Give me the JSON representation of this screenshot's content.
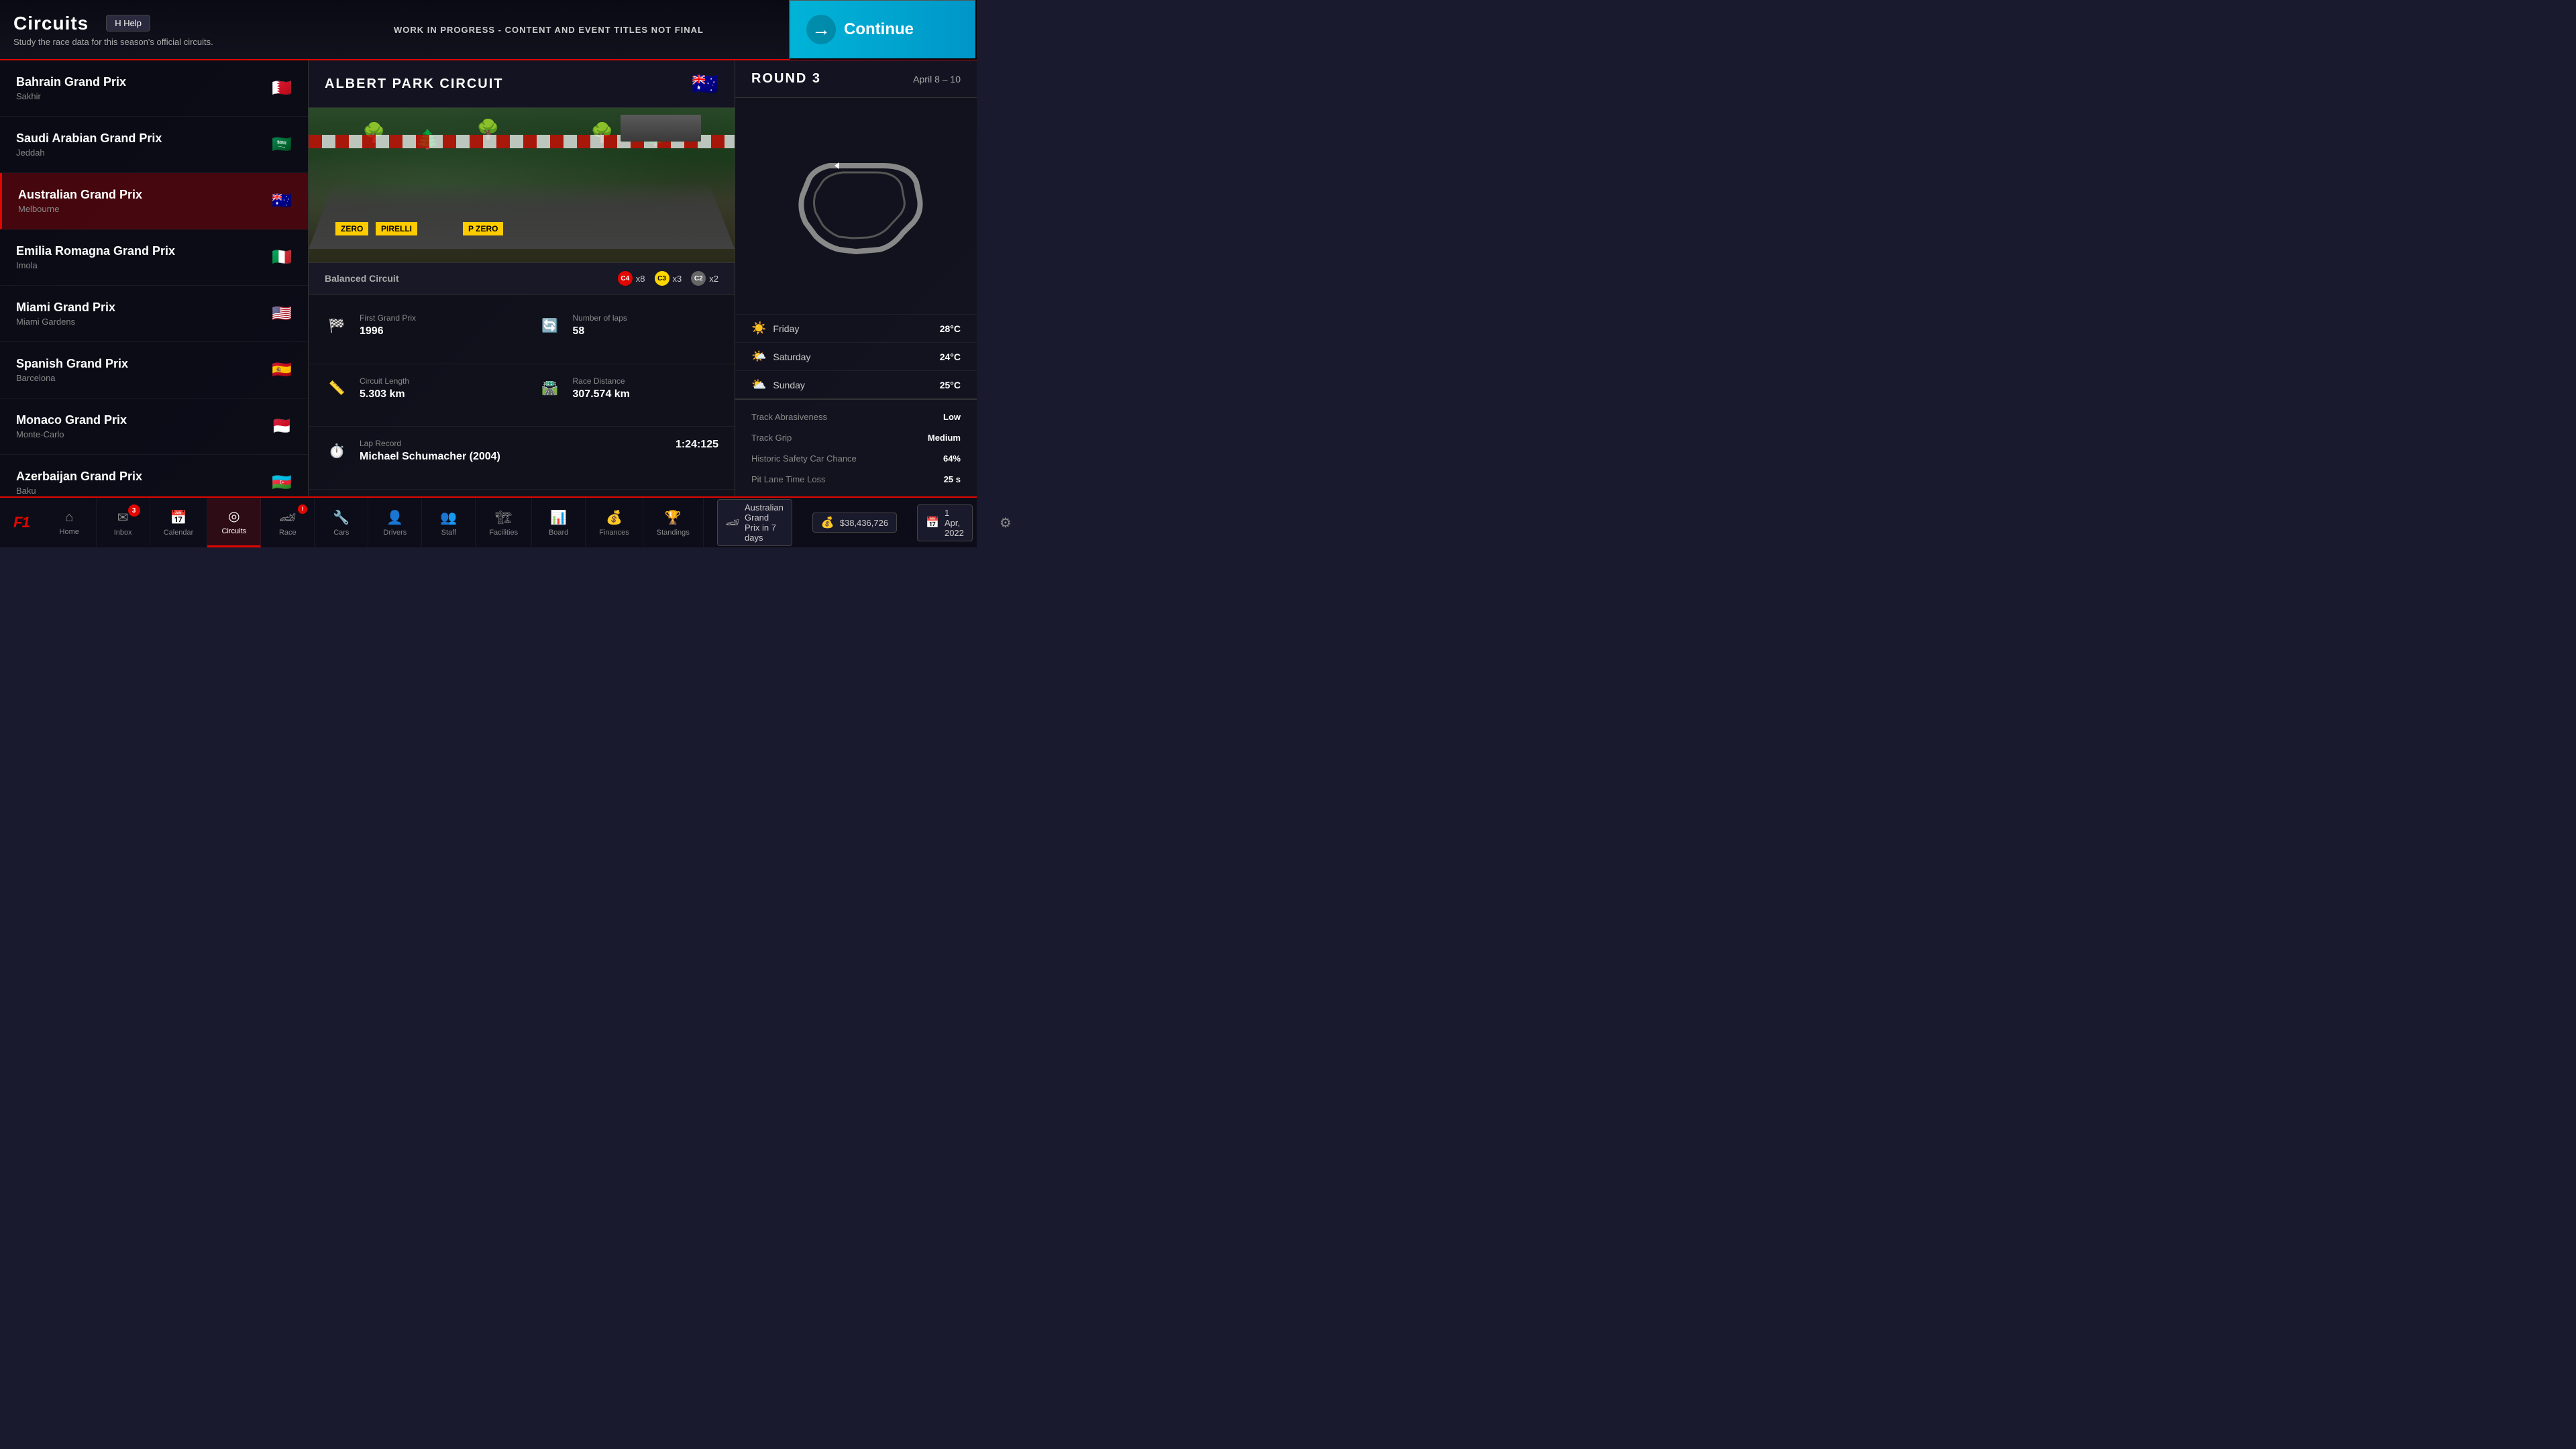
{
  "header": {
    "title": "Circuits",
    "subtitle": "Study the race data for this season's official circuits.",
    "help_label": "H  Help",
    "wip_notice": "WORK IN PROGRESS - CONTENT AND EVENT TITLES NOT FINAL",
    "continue_label": "Continue"
  },
  "circuits": [
    {
      "id": "bahrain",
      "name": "Bahrain Grand Prix",
      "city": "Sakhir",
      "flag": "🇧🇭",
      "active": false
    },
    {
      "id": "saudi",
      "name": "Saudi Arabian Grand Prix",
      "city": "Jeddah",
      "flag": "🇸🇦",
      "active": false
    },
    {
      "id": "australia",
      "name": "Australian Grand Prix",
      "city": "Melbourne",
      "flag": "🇦🇺",
      "active": true
    },
    {
      "id": "emilia",
      "name": "Emilia Romagna Grand Prix",
      "city": "Imola",
      "flag": "🇮🇹",
      "active": false
    },
    {
      "id": "miami",
      "name": "Miami Grand Prix",
      "city": "Miami Gardens",
      "flag": "🇺🇸",
      "active": false
    },
    {
      "id": "spanish",
      "name": "Spanish Grand Prix",
      "city": "Barcelona",
      "flag": "🇪🇸",
      "active": false
    },
    {
      "id": "monaco",
      "name": "Monaco Grand Prix",
      "city": "Monte-Carlo",
      "flag": "🇲🇨",
      "active": false
    },
    {
      "id": "azerbaijan",
      "name": "Azerbaijan Grand Prix",
      "city": "Baku",
      "flag": "🇦🇿",
      "active": false
    }
  ],
  "circuit_detail": {
    "name": "ALBERT PARK CIRCUIT",
    "flag": "🇦🇺",
    "type": "Balanced Circuit",
    "tyres": [
      {
        "compound": "C4",
        "count": "x8",
        "type": "soft"
      },
      {
        "compound": "C3",
        "count": "x3",
        "type": "medium"
      },
      {
        "compound": "C2",
        "count": "x2",
        "type": "hard"
      }
    ],
    "stats": {
      "first_gp_label": "First Grand Prix",
      "first_gp_value": "1996",
      "laps_label": "Number of laps",
      "laps_value": "58",
      "length_label": "Circuit Length",
      "length_value": "5.303 km",
      "distance_label": "Race Distance",
      "distance_value": "307.574 km",
      "lap_record_label": "Lap Record",
      "lap_record_holder": "Michael Schumacher (2004)",
      "lap_record_time": "1:24:125"
    }
  },
  "round": {
    "label": "ROUND 3",
    "dates": "April 8 – 10"
  },
  "weather": [
    {
      "day": "Friday",
      "icon": "☀️",
      "temp": "28°C"
    },
    {
      "day": "Saturday",
      "icon": "🌤️",
      "temp": "24°C"
    },
    {
      "day": "Sunday",
      "icon": "⛅",
      "temp": "25°C"
    }
  ],
  "track_info": {
    "abrasiveness_label": "Track Abrasiveness",
    "abrasiveness_value": "Low",
    "grip_label": "Track Grip",
    "grip_value": "Medium",
    "safety_car_label": "Historic Safety Car Chance",
    "safety_car_value": "64%",
    "pit_loss_label": "Pit Lane Time Loss",
    "pit_loss_value": "25 s"
  },
  "status_bar": {
    "event": "Australian Grand Prix in 7 days",
    "money": "$38,436,726",
    "date": "1 Apr, 2022"
  },
  "nav": [
    {
      "id": "home",
      "label": "Home",
      "icon": "⌂",
      "active": false,
      "badge": null
    },
    {
      "id": "inbox",
      "label": "Inbox",
      "icon": "✉",
      "active": false,
      "badge": "3"
    },
    {
      "id": "calendar",
      "label": "Calendar",
      "icon": "📅",
      "active": false,
      "badge": null
    },
    {
      "id": "circuits",
      "label": "Circuits",
      "icon": "◎",
      "active": true,
      "badge": null
    },
    {
      "id": "race",
      "label": "Race",
      "icon": "🏎",
      "active": false,
      "badge": "!"
    },
    {
      "id": "cars",
      "label": "Cars",
      "icon": "🔧",
      "active": false,
      "badge": null
    },
    {
      "id": "drivers",
      "label": "Drivers",
      "icon": "👤",
      "active": false,
      "badge": null
    },
    {
      "id": "staff",
      "label": "Staff",
      "icon": "👥",
      "active": false,
      "badge": null
    },
    {
      "id": "facilities",
      "label": "Facilities",
      "icon": "🏗",
      "active": false,
      "badge": null
    },
    {
      "id": "board",
      "label": "Board",
      "icon": "📊",
      "active": false,
      "badge": null
    },
    {
      "id": "finances",
      "label": "Finances",
      "icon": "💰",
      "active": false,
      "badge": null
    },
    {
      "id": "standings",
      "label": "Standings",
      "icon": "🏆",
      "active": false,
      "badge": null
    }
  ]
}
